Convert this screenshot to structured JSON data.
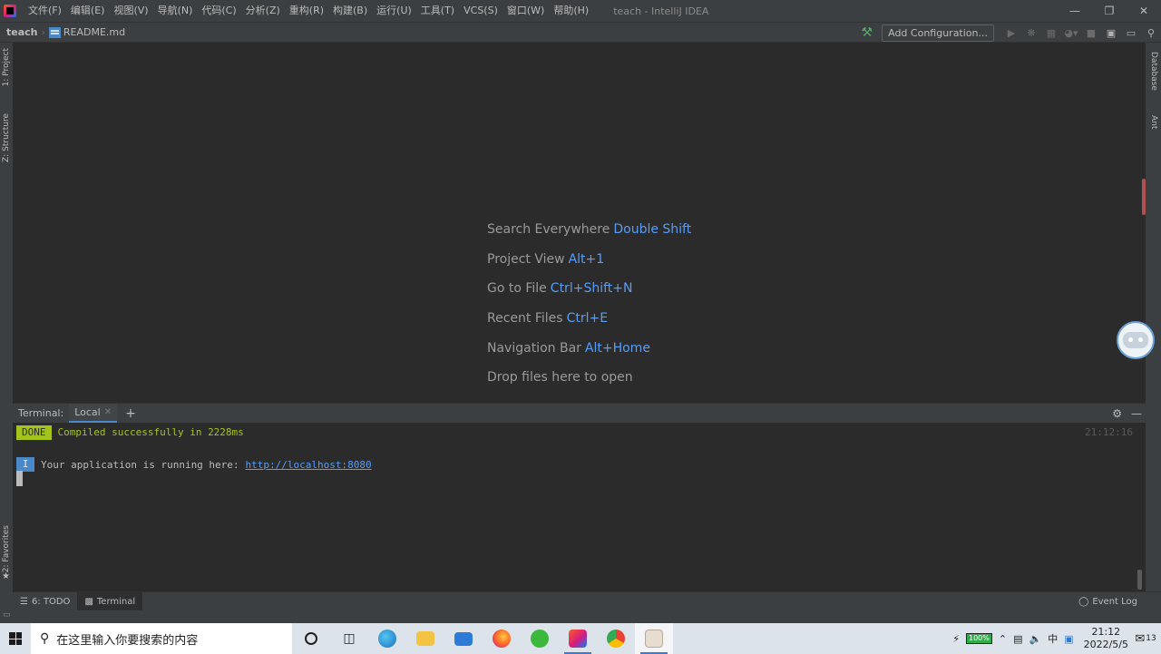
{
  "menu": [
    "文件(F)",
    "编辑(E)",
    "视图(V)",
    "导航(N)",
    "代码(C)",
    "分析(Z)",
    "重构(R)",
    "构建(B)",
    "运行(U)",
    "工具(T)",
    "VCS(S)",
    "窗口(W)",
    "帮助(H)"
  ],
  "window_title": "teach - IntelliJ IDEA",
  "nav": {
    "project": "teach",
    "file": "README.md",
    "add_configuration": "Add Configuration..."
  },
  "left_tools": {
    "project": "1: Project",
    "structure": "Z: Structure",
    "favorites": "2: Favorites"
  },
  "right_tools": {
    "database": "Database",
    "ant": "Ant"
  },
  "hints": [
    {
      "label": "Search Everywhere",
      "key": "Double Shift"
    },
    {
      "label": "Project View",
      "key": "Alt+1"
    },
    {
      "label": "Go to File",
      "key": "Ctrl+Shift+N"
    },
    {
      "label": "Recent Files",
      "key": "Ctrl+E"
    },
    {
      "label": "Navigation Bar",
      "key": "Alt+Home"
    },
    {
      "label": "Drop files here to open",
      "key": ""
    }
  ],
  "terminal": {
    "title": "Terminal:",
    "tab": "Local",
    "done_badge": "DONE",
    "compiled": "Compiled successfully in 2228ms",
    "time": "21:12:16",
    "info_badge": "I",
    "running": "Your application is running here:",
    "url": "http://localhost:8080"
  },
  "bottom_tabs": {
    "todo": "6: TODO",
    "terminal": "Terminal",
    "event_log": "Event Log"
  },
  "taskbar": {
    "search_placeholder": "在这里输入你要搜索的内容",
    "battery": "100%",
    "ime": "中",
    "time": "21:12",
    "date": "2022/5/5",
    "notifications": "13"
  },
  "colors": {
    "editor_bg": "#2b2b2b",
    "panel_bg": "#3c3f41",
    "shortcut": "#589df6",
    "done": "#a3c41d",
    "info": "#4a88c7"
  }
}
